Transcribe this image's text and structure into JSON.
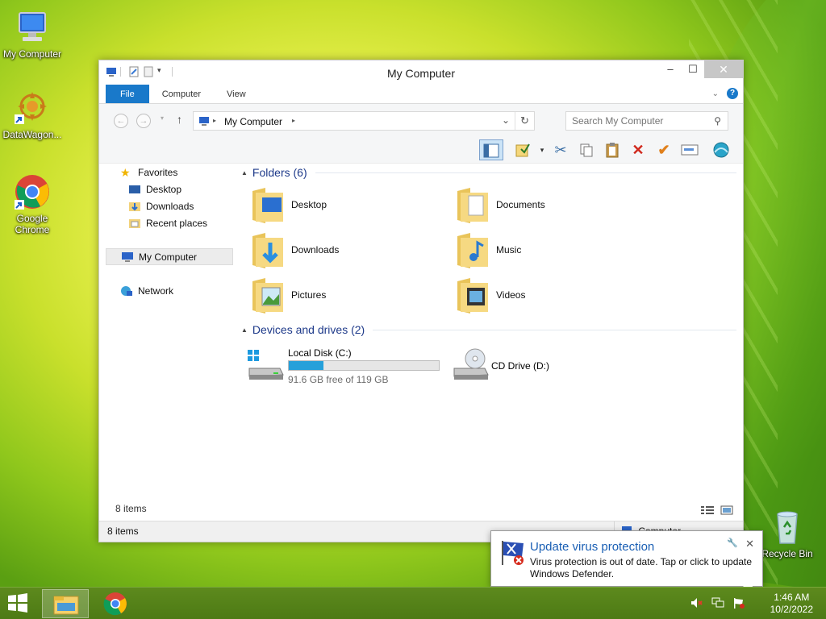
{
  "desktop": {
    "icons": [
      {
        "label": "My Computer"
      },
      {
        "label": "DataWagon..."
      },
      {
        "label": "Google Chrome"
      },
      {
        "label": "Recycle Bin"
      }
    ]
  },
  "window": {
    "title": "My Computer",
    "ribbon_tabs": [
      "File",
      "Computer",
      "View"
    ],
    "address": "My Computer",
    "search_placeholder": "Search My Computer",
    "nav": {
      "favorites": "Favorites",
      "favorite_items": [
        "Desktop",
        "Downloads",
        "Recent places"
      ],
      "computer": "My Computer",
      "network": "Network"
    },
    "groups": {
      "folders": "Folders (6)",
      "devices": "Devices and drives (2)"
    },
    "folders": [
      "Desktop",
      "Documents",
      "Downloads",
      "Music",
      "Pictures",
      "Videos"
    ],
    "drives": [
      {
        "name": "Local Disk (C:)",
        "free_text": "91.6 GB free of 119 GB",
        "used_fraction": 0.23
      },
      {
        "name": "CD Drive (D:)"
      }
    ],
    "item_count_inner": "8 items",
    "status_left": "8 items",
    "status_zone": "Computer"
  },
  "toast": {
    "title": "Update virus protection",
    "body": "Virus protection is out of date. Tap or click to update Windows Defender."
  },
  "taskbar": {
    "time": "1:46 AM",
    "date": "10/2/2022"
  },
  "colors": {
    "accent": "#1979ca",
    "progress": "#26a0da",
    "taskbar": "#4d7a15"
  }
}
